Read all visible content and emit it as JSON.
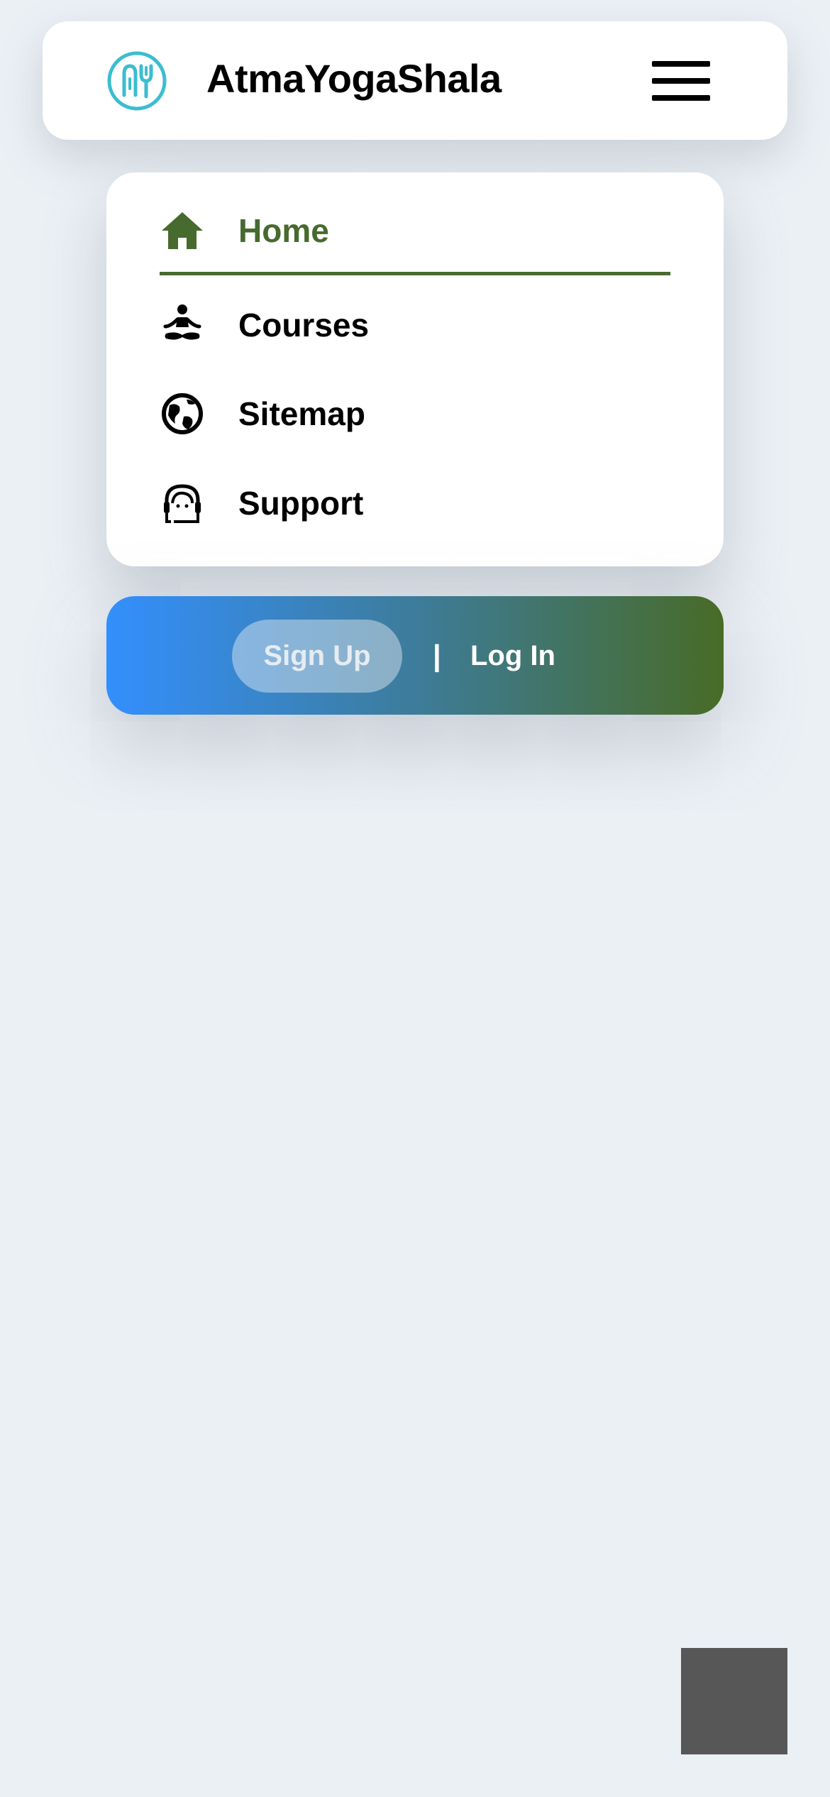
{
  "header": {
    "brand": "AtmaYogaShala",
    "logo_icon": "atma-yoga-logo-icon",
    "menu_icon": "hamburger-menu-icon",
    "logo_color": "#3bbdd0"
  },
  "nav": {
    "accent_color": "#476a2e",
    "items": [
      {
        "label": "Home",
        "icon": "home-icon",
        "active": true
      },
      {
        "label": "Courses",
        "icon": "meditation-icon",
        "active": false
      },
      {
        "label": "Sitemap",
        "icon": "globe-icon",
        "active": false
      },
      {
        "label": "Support",
        "icon": "headset-support-icon",
        "active": false
      }
    ]
  },
  "auth": {
    "signup_label": "Sign Up",
    "separator": "|",
    "login_label": "Log In",
    "gradient_start": "#338ffd",
    "gradient_end": "#486b27"
  }
}
